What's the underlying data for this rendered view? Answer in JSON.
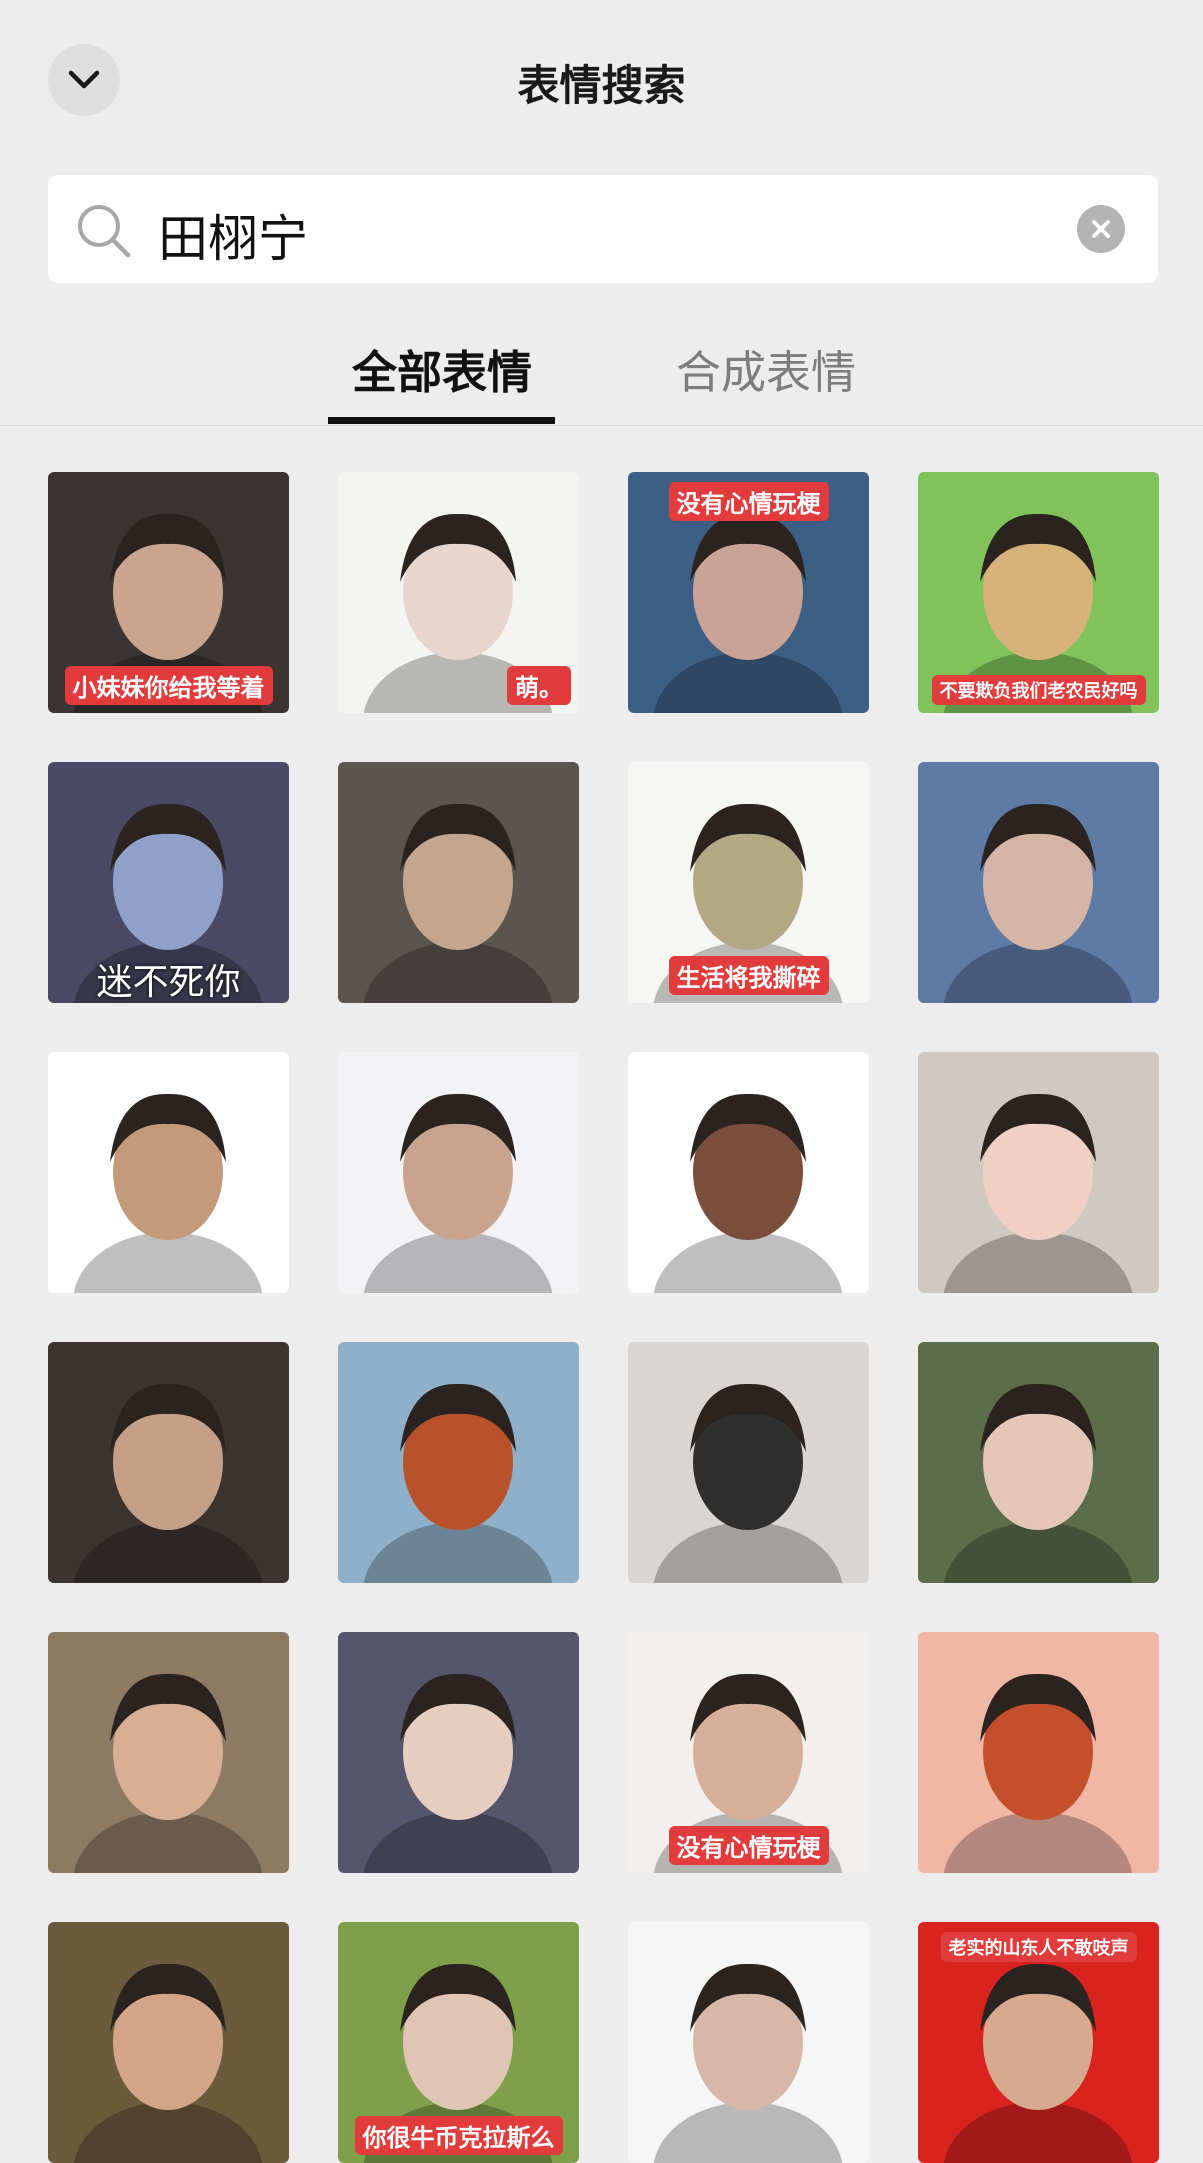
{
  "header": {
    "title": "表情搜索",
    "collapse_icon": "chevron-down-icon"
  },
  "search": {
    "query": "田栩宁",
    "search_icon": "search-icon",
    "clear_icon": "clear-icon"
  },
  "tabs": [
    {
      "label": "全部表情",
      "active": true
    },
    {
      "label": "合成表情",
      "active": false
    }
  ],
  "stickers": [
    {
      "caption": "小妹妹你给我等着",
      "bg": "#3a3533",
      "fg": "#c9a58f"
    },
    {
      "caption": "萌。",
      "bg": "#f4f4f2",
      "fg": "#e8d6cc"
    },
    {
      "caption": "没有心情玩梗",
      "bg": "#3d5f86",
      "fg": "#c9a394"
    },
    {
      "caption": "不要欺负我们老农民好吗",
      "bg": "#7fc35a",
      "fg": "#d8b27b"
    },
    {
      "caption": "迷不死你",
      "bg": "#4a4a66",
      "fg": "#8fa1c9"
    },
    {
      "caption": "",
      "bg": "#5b5550",
      "fg": "#c4a58e"
    },
    {
      "caption": "生活将我撕碎",
      "bg": "#f6f6f4",
      "fg": "#b4a985"
    },
    {
      "caption": "",
      "bg": "#5e7aa5",
      "fg": "#d5b6a6"
    },
    {
      "caption": "",
      "bg": "#ffffff",
      "fg": "#c49b7a"
    },
    {
      "caption": "",
      "bg": "#f3f3f6",
      "fg": "#c8a48f"
    },
    {
      "caption": "",
      "bg": "#ffffff",
      "fg": "#7a4d3c"
    },
    {
      "caption": "",
      "bg": "#cfc9c1",
      "fg": "#f0d0c4"
    },
    {
      "caption": "",
      "bg": "#3b3431",
      "fg": "#c5a089"
    },
    {
      "caption": "",
      "bg": "#8fb0c8",
      "fg": "#b9522a"
    },
    {
      "caption": "",
      "bg": "#d8d5d2",
      "fg": "#2f2f2f"
    },
    {
      "caption": "",
      "bg": "#5c6d4a",
      "fg": "#e5c7b8"
    },
    {
      "caption": "",
      "bg": "#8e7a63",
      "fg": "#d8ae94"
    },
    {
      "caption": "",
      "bg": "#55566d",
      "fg": "#e7cdbf"
    },
    {
      "caption": "没有心情玩梗",
      "bg": "#f2f0ee",
      "fg": "#d7b09b"
    },
    {
      "caption": "",
      "bg": "#f0b6a6",
      "fg": "#c4502b"
    },
    {
      "caption": "",
      "bg": "#6c5a3d",
      "fg": "#d4a487"
    },
    {
      "caption": "你很牛币克拉斯么",
      "bg": "#7ea04a",
      "fg": "#e0c5b5"
    },
    {
      "caption": "",
      "bg": "#f6f6f6",
      "fg": "#d7b8a8"
    },
    {
      "caption": "老实的山东人不敢吱声",
      "bg": "#d9231f",
      "fg": "#d7a98f"
    }
  ]
}
